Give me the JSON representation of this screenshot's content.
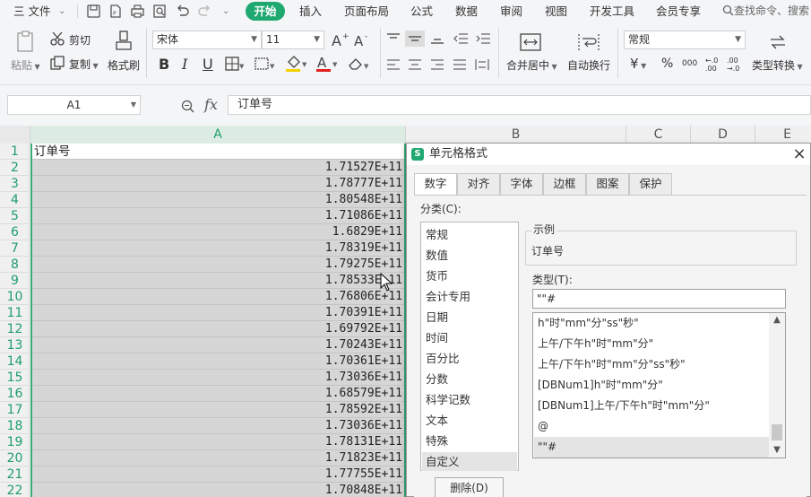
{
  "menu": {
    "file": "三 文件",
    "tab_start": "开始",
    "tabs": [
      "插入",
      "页面布局",
      "公式",
      "数据",
      "审阅",
      "视图",
      "开发工具",
      "会员专享"
    ],
    "search": "查找命令、搜索"
  },
  "ribbon": {
    "paste": "粘贴",
    "cut": "剪切",
    "copy": "复制",
    "format_painter": "格式刷",
    "font_name": "宋体",
    "font_size": "11",
    "bold": "B",
    "italic": "I",
    "underline": "U",
    "merge_center": "合并居中",
    "wrap_text": "自动换行",
    "number_format": "常规",
    "currency_symbol": "¥",
    "percent_symbol": "%",
    "thousands": "000",
    "inc_decimal": "←.0 .00",
    "dec_decimal": ".00 →.0",
    "type_convert": "类型转换"
  },
  "formula_bar": {
    "name_box": "A1",
    "fx": "fx",
    "content": "订单号"
  },
  "grid": {
    "columns": [
      "A",
      "B",
      "C",
      "D",
      "E"
    ],
    "rows": [
      "1",
      "2",
      "3",
      "4",
      "5",
      "6",
      "7",
      "8",
      "9",
      "10",
      "11",
      "12",
      "13",
      "14",
      "15",
      "16",
      "17",
      "18",
      "19",
      "20",
      "21",
      "22"
    ],
    "colA": [
      "订单号",
      "1.71527E+11",
      "1.78777E+11",
      "1.80548E+11",
      "1.71086E+11",
      "1.6829E+11",
      "1.78319E+11",
      "1.79275E+11",
      "1.78533E+11",
      "1.76806E+11",
      "1.70391E+11",
      "1.69792E+11",
      "1.70243E+11",
      "1.70361E+11",
      "1.73036E+11",
      "1.68579E+11",
      "1.78592E+11",
      "1.73036E+11",
      "1.78131E+11",
      "1.71823E+11",
      "1.77755E+11",
      "1.70848E+11"
    ]
  },
  "dialog": {
    "title": "单元格格式",
    "close": "×",
    "tabs": [
      "数字",
      "对齐",
      "字体",
      "边框",
      "图案",
      "保护"
    ],
    "category_label": "分类(C):",
    "categories": [
      "常规",
      "数值",
      "货币",
      "会计专用",
      "日期",
      "时间",
      "百分比",
      "分数",
      "科学记数",
      "文本",
      "特殊",
      "自定义"
    ],
    "sample_label": "示例",
    "sample_value": "订单号",
    "type_label": "类型(T):",
    "type_value": "\"\"#",
    "type_items": [
      "h\"时\"mm\"分\"ss\"秒\"",
      "上午/下午h\"时\"mm\"分\"",
      "上午/下午h\"时\"mm\"分\"ss\"秒\"",
      "[DBNum1]h\"时\"mm\"分\"",
      "[DBNum1]上午/下午h\"时\"mm\"分\"",
      "@",
      "\"\"#"
    ],
    "delete_button": "删除(D)"
  },
  "colors": {
    "accent": "#1fa971",
    "selection_border": "#3aa776",
    "selected_fill": "#d6d6d6"
  }
}
